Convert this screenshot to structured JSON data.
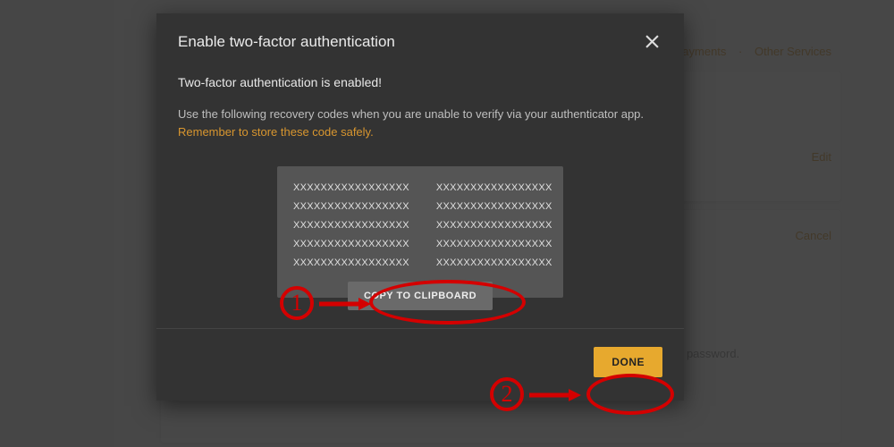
{
  "modal": {
    "title": "Enable two-factor authentication",
    "heading": "Two-factor authentication is enabled!",
    "instruction_prefix": "Use the following recovery codes when you are unable to verify via your authenticator app. ",
    "instruction_link": "Remember to store these code safely.",
    "codes": [
      "XXXXXXXXXXXXXXXXX",
      "XXXXXXXXXXXXXXXXX",
      "XXXXXXXXXXXXXXXXX",
      "XXXXXXXXXXXXXXXXX",
      "XXXXXXXXXXXXXXXXX",
      "XXXXXXXXXXXXXXXXX",
      "XXXXXXXXXXXXXXXXX",
      "XXXXXXXXXXXXXXXXX",
      "XXXXXXXXXXXXXXXXX",
      "XXXXXXXXXXXXXXXXX"
    ],
    "copy_label": "COPY TO CLIPBOARD",
    "done_label": "DONE"
  },
  "background": {
    "nav_payments": "Payments",
    "nav_other": "Other Services",
    "edit": "Edit",
    "cancel": "Cancel",
    "pw_fragment": "r password."
  },
  "annotations": {
    "step1": "1",
    "step2": "2"
  },
  "colors": {
    "accent": "#e7a92e",
    "modal_bg": "#333333",
    "annotation": "#d40000"
  }
}
